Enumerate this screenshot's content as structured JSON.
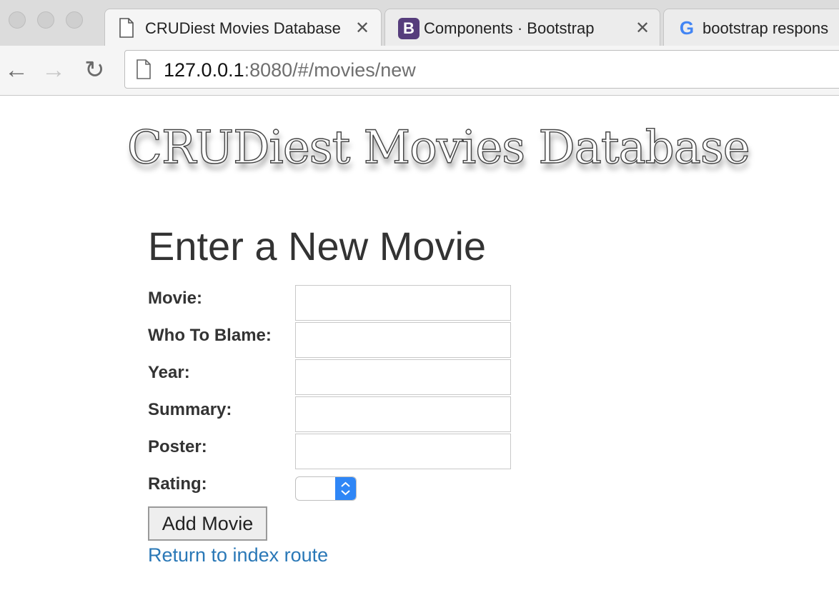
{
  "browser": {
    "tabs": [
      {
        "title": "CRUDiest Movies Database",
        "icon": "page-icon",
        "active": true
      },
      {
        "title": "Components · Bootstrap",
        "icon": "bootstrap-b-icon",
        "active": false
      },
      {
        "title": "bootstrap respons",
        "icon": "google-g-icon",
        "active": false
      }
    ],
    "tab_close_glyph": "✕",
    "url_host": "127.0.0.1",
    "url_rest": ":8080/#/movies/new",
    "nav": {
      "back": "←",
      "forward": "→",
      "reload": "↻"
    }
  },
  "page": {
    "site_title": "CRUDiest Movies Database",
    "form_heading": "Enter a New Movie",
    "fields": [
      {
        "label": "Movie:",
        "value": ""
      },
      {
        "label": "Who To Blame:",
        "value": ""
      },
      {
        "label": "Year:",
        "value": ""
      },
      {
        "label": "Summary:",
        "value": ""
      },
      {
        "label": "Poster:",
        "value": ""
      }
    ],
    "rating": {
      "label": "Rating:",
      "selected": ""
    },
    "submit_label": "Add Movie",
    "return_link": "Return to index route"
  },
  "colors": {
    "link": "#2a78b7",
    "select_accent": "#2f86f6",
    "heading": "#333333"
  }
}
